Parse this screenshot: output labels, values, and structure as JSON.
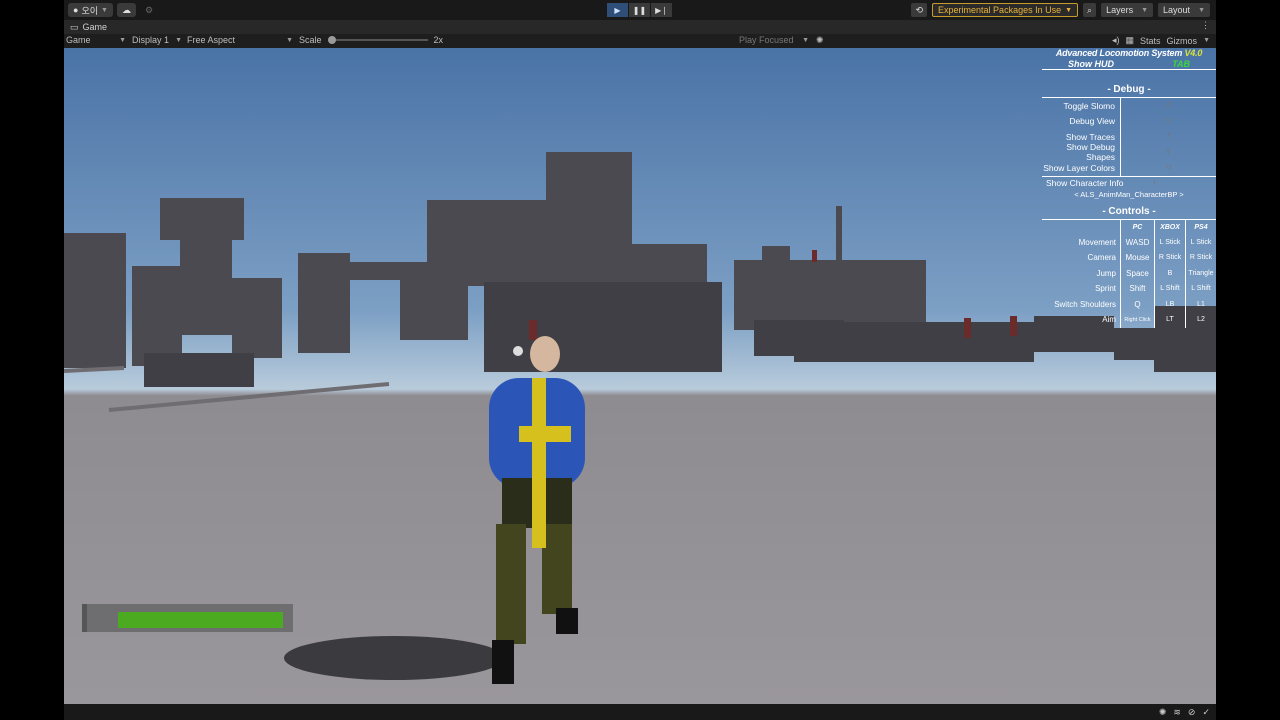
{
  "toolbar": {
    "account_label": "오이",
    "experimental_packages": "Experimental Packages In Use",
    "layers_label": "Layers",
    "layout_label": "Layout"
  },
  "tab": {
    "label": "Game"
  },
  "gamebar": {
    "mode": "Game",
    "display": "Display 1",
    "aspect": "Free Aspect",
    "scale_label": "Scale",
    "scale_value": "2x",
    "play_focused": "Play Focused",
    "stats": "Stats",
    "gizmos": "Gizmos"
  },
  "hud": {
    "title": "Advanced Locomotion System",
    "version": "V4.0",
    "show_hud_label": "Show HUD",
    "show_hud_key": "TAB",
    "debug_title": "- Debug -",
    "debug_rows": [
      {
        "label": "Toggle Slomo",
        "key": "Z"
      },
      {
        "label": "Debug View",
        "key": "V"
      },
      {
        "label": "Show Traces",
        "key": "T"
      },
      {
        "label": "Show Debug Shapes",
        "key": "Y"
      },
      {
        "label": "Show Layer Colors",
        "key": "U"
      }
    ],
    "char_info_label": "Show Character Info",
    "char_info_key": "I",
    "character": "ALS_AnimMan_CharacterBP",
    "controls_title": "- Controls -",
    "controls_header": [
      "PC",
      "XBOX",
      "PS4"
    ],
    "controls": [
      {
        "action": "Movement",
        "pc": "WASD",
        "xbox": "L Stick",
        "ps4": "L Stick"
      },
      {
        "action": "Camera",
        "pc": "Mouse",
        "xbox": "R Stick",
        "ps4": "R Stick"
      },
      {
        "action": "Jump",
        "pc": "Space",
        "xbox": "B",
        "ps4": "Triangle"
      },
      {
        "action": "Sprint",
        "pc": "Shift",
        "xbox": "L Shift",
        "ps4": "L Shift"
      },
      {
        "action": "Switch Shoulders",
        "pc": "Q",
        "xbox": "LB",
        "ps4": "L1"
      },
      {
        "action": "Aim",
        "pc": "Right Click",
        "xbox": "LT",
        "ps4": "L2"
      }
    ]
  },
  "health": {
    "level": 0.98,
    "color": "#4caa20"
  },
  "colors": {
    "accent_play": "#2f4f78",
    "warning": "#e8b23a",
    "hud_key_green": "#3cd63c",
    "version_yellow": "#d8e23a"
  }
}
